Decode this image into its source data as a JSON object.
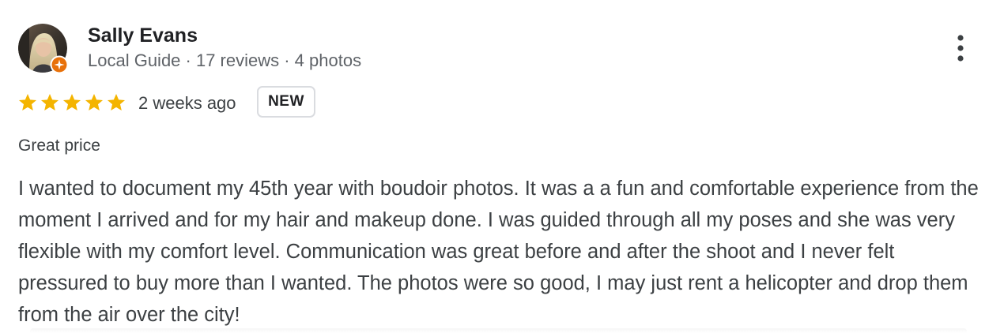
{
  "reviewer": {
    "name": "Sally Evans",
    "meta": "Local Guide · 17 reviews · 4 photos",
    "badge_color": "#e8710a"
  },
  "rating": {
    "stars": 5,
    "max": 5,
    "star_color": "#f4b400"
  },
  "review": {
    "date": "2 weeks ago",
    "new_badge": "NEW",
    "tag": "Great price",
    "text": "I wanted to document my 45th year with boudoir photos. It was a a fun and comfortable experience from the moment I arrived and for my hair and makeup done. I was guided through all my poses and she was very flexible with my comfort level. Communication was great before and after the shoot and I never felt pressured to buy more than I wanted. The photos were so good, I may just rent a helicopter and drop them from the air over the city!"
  },
  "icons": {
    "more": "more-vert-icon",
    "star": "star-icon",
    "guide_badge": "local-guide-badge-icon"
  }
}
